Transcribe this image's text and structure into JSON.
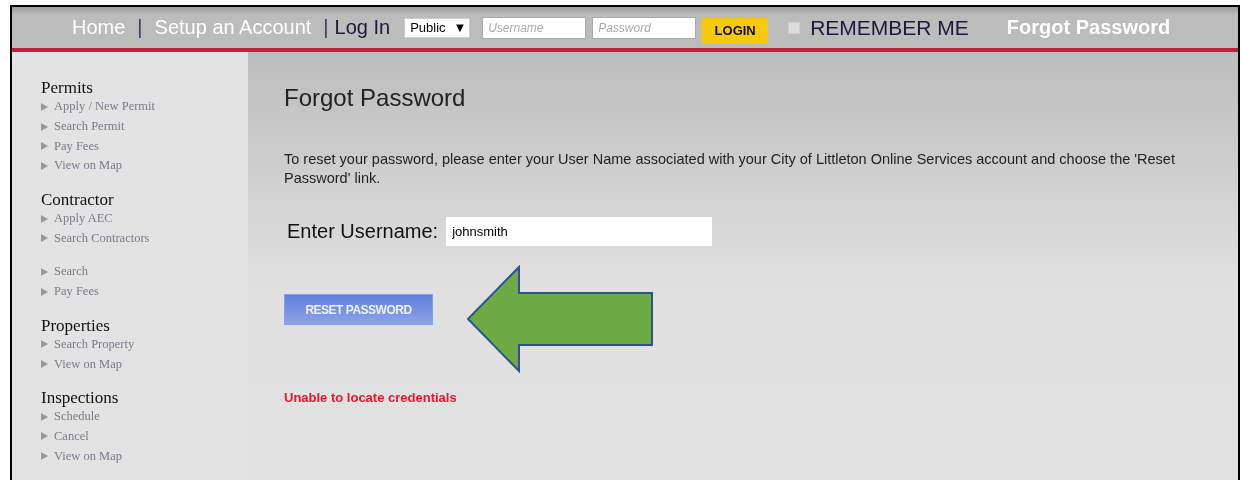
{
  "header": {
    "nav": [
      {
        "label": "Home",
        "kind": "link"
      },
      {
        "label": "|",
        "kind": "separator"
      },
      {
        "label": "Setup an Account",
        "kind": "link"
      },
      {
        "label": "|",
        "kind": "separator"
      },
      {
        "label": "Log In",
        "kind": "label"
      }
    ],
    "account_type": {
      "value": "Public",
      "caret": "▼"
    },
    "username": {
      "placeholder": "Username"
    },
    "password": {
      "placeholder": "Password"
    },
    "login_button": "LOGIN",
    "remember_me": {
      "label": "REMEMBER ME",
      "checked": false
    },
    "forgot_link": "Forgot Password"
  },
  "sidebar": [
    {
      "heading": "Permits",
      "items": [
        "Apply / New Permit",
        "Search Permit",
        "Pay Fees",
        "View on Map"
      ]
    },
    {
      "heading": "Contractor",
      "items": [
        "Apply AEC",
        "Search Contractors"
      ]
    },
    {
      "items": [
        "Search",
        "Pay Fees"
      ]
    },
    {
      "heading": "Properties",
      "items": [
        "Search Property",
        "View on Map"
      ]
    },
    {
      "heading": "Inspections",
      "items": [
        "Schedule",
        "Cancel",
        "View on Map"
      ]
    }
  ],
  "main": {
    "title": "Forgot Password",
    "instructions": "To reset your password, please enter your User Name associated with your City of Littleton Online Services account and choose the 'Reset Password' link.",
    "username_label": "Enter Username:",
    "username_value": "johnsmith",
    "reset_button": "RESET PASSWORD",
    "error": "Unable to locate credentials"
  }
}
